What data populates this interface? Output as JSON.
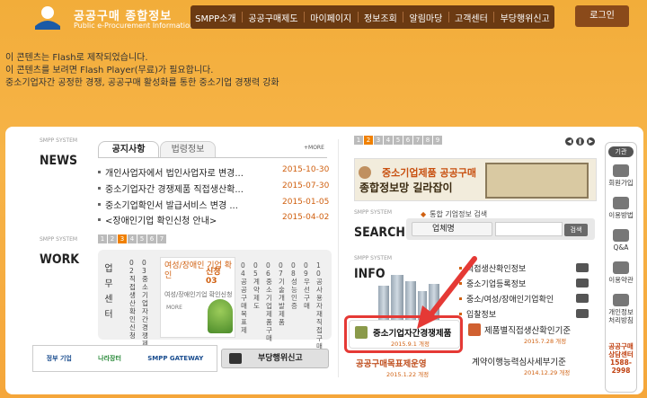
{
  "header": {
    "logo_title": "공공구매 종합정보",
    "logo_sub": "Public e-Procurement Information",
    "menu": [
      "SMPP소개",
      "공공구매제도",
      "마이페이지",
      "정보조회",
      "알림마당",
      "고객센터",
      "부당행위신고"
    ],
    "login": "로그인"
  },
  "flash": {
    "line1": "이 콘텐츠는 Flash로 제작되었습니다.",
    "line2": "이 콘텐츠를 보려면 Flash Player(무료)가 필요합니다.",
    "line3": "중소기업자간 공정한 경쟁, 공공구매 활성화를 통한 중소기업 경쟁력 강화"
  },
  "news": {
    "system": "SMPP SYSTEM",
    "title": "NEWS",
    "tab_active": "공지사항",
    "tab_other": "법령정보",
    "more": "MORE",
    "items": [
      {
        "title": "개인사업자에서 법인사업자로 변경...",
        "date": "2015-10-30"
      },
      {
        "title": "중소기업자간 경쟁제품 직접생산확...",
        "date": "2015-07-30"
      },
      {
        "title": "중소기업확인서 발급서비스 변경 ...",
        "date": "2015-01-05"
      },
      {
        "title": "<장애인기업 확인신청 안내>",
        "date": "2015-04-02"
      }
    ]
  },
  "work": {
    "system": "SMPP SYSTEM",
    "title": "WORK",
    "pages": [
      "1",
      "2",
      "3",
      "4",
      "5",
      "6",
      "7"
    ],
    "active_page": "3",
    "category": "업무센터",
    "cols_a": [
      "02 직접생산확인신청",
      "03 중소기업자간경쟁제품"
    ],
    "card_heading": "여성/장애인 기업 확인",
    "card_tag": "신청 03",
    "card_sub": "여성/장애인기업 확인신청",
    "card_more": "MORE",
    "cols_b": [
      "04 공공구매목표제",
      "05 계약제도",
      "06 중소기업제품구매",
      "07 기술개발제품",
      "08 성능인증",
      "09 우선구매",
      "10 공사용자재직접구매"
    ]
  },
  "banners": {
    "items": [
      "정부 기업",
      "나라장터",
      "SMPP GATEWAY"
    ],
    "report_button": "부당행위신고"
  },
  "promo": {
    "pages": [
      "1",
      "2",
      "3",
      "4",
      "5",
      "6",
      "7",
      "8",
      "9"
    ],
    "line1": "중소기업제품 공공구매",
    "line2": "종합정보망 길라잡이"
  },
  "search": {
    "system": "SMPP SYSTEM",
    "title": "SEARCH",
    "label": "통합 기업정보 검색",
    "select_value": "업체명",
    "button": "검색"
  },
  "info": {
    "system": "SMPP SYSTEM",
    "title": "INFO",
    "items": [
      "직접생산확인정보",
      "중소기업등록정보",
      "중소/여성/장애인기업확인",
      "입찰정보"
    ],
    "cards": [
      {
        "title": "중소기업자간경쟁제품",
        "date": "2015.9.1 개정"
      },
      {
        "title": "제품별직접생산확인기준",
        "date": "2015.7.28 개정"
      },
      {
        "title": "공공구매목표제운영",
        "date": "2015.1.22 개정"
      },
      {
        "title": "계약이행능력심사세부기준",
        "date": "2014.12.29 개정"
      }
    ]
  },
  "quick_menu": {
    "top": "기관",
    "items": [
      "회원가입",
      "이용방법",
      "Q&A",
      "이용약관",
      "개인정보처리방침"
    ],
    "call": "공공구매상담센터",
    "phone": "1588-2998"
  }
}
